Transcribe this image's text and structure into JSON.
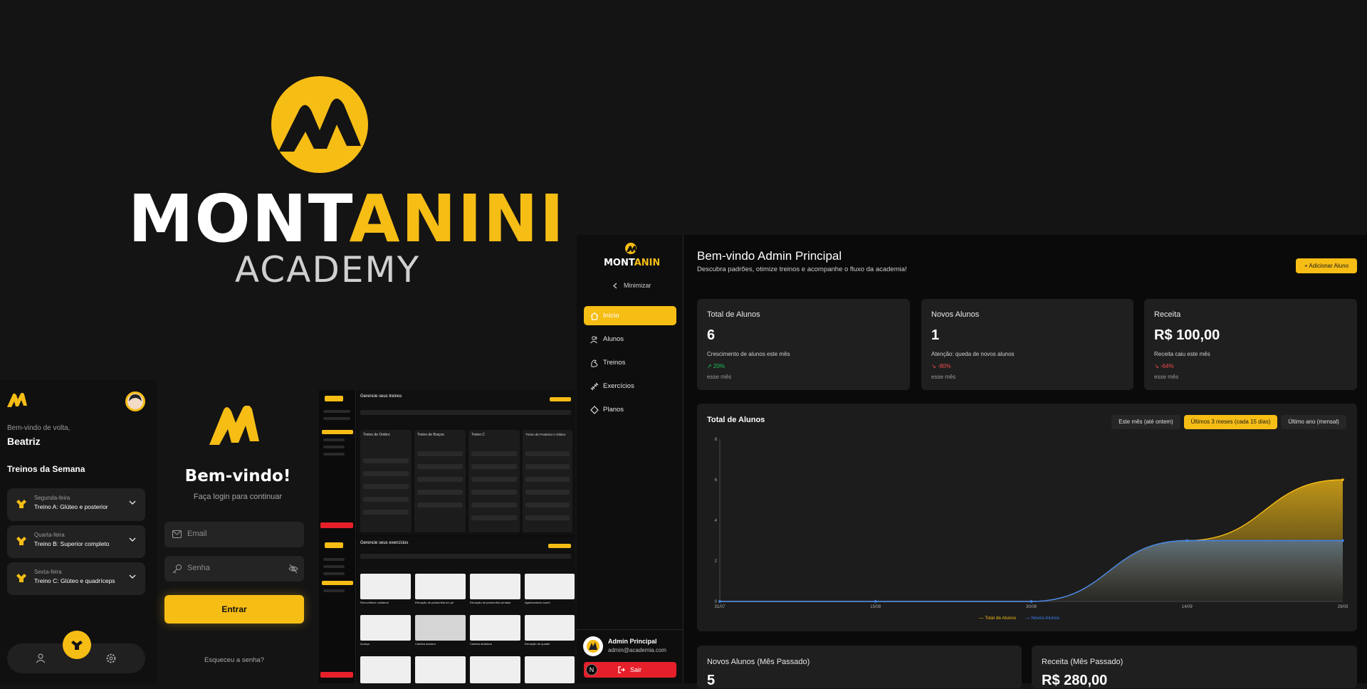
{
  "brand": {
    "word_white": "MONT",
    "word_yellow": "ANINI",
    "subtitle": "ACADEMY",
    "accent": "#f6bd15"
  },
  "mobile": {
    "greeting": "Bem-vindo de volta,",
    "user_name": "Beatriz",
    "section_title": "Treinos da Semana",
    "workouts": [
      {
        "day": "Segunda-feira",
        "title": "Treino A: Glúteo e posterior"
      },
      {
        "day": "Quarta-feira",
        "title": "Treino B: Superior completo"
      },
      {
        "day": "Sexta-feira",
        "title": "Treino C: Glúteo e quadríceps"
      }
    ],
    "nav_icons": [
      "user-icon",
      "dumbbell-icon",
      "gear-icon"
    ]
  },
  "login": {
    "title": "Bem-vindo!",
    "subtitle": "Faça login para continuar",
    "email_placeholder": "Email",
    "password_placeholder": "Senha",
    "submit_label": "Entrar",
    "forgot_label": "Esqueceu a senha?"
  },
  "mini": {
    "screen1_title": "Gerencie seus treinos",
    "screen1_columns": [
      "Treino de Ombro",
      "Treino de Braços",
      "Treino C",
      "Treino de Posterior e Glúteo"
    ],
    "screen2_title": "Gerencie seus exercícios",
    "screen2_captions": [
      "Remo/sflexe unilateral",
      "Elevação de panturrilha em pé",
      "Elevação de panturrilha sentado",
      "Agachamento sumô",
      "Avanço",
      "Cadeira adutora",
      "Cadeira abdutora",
      "Elevação de quadril"
    ]
  },
  "admin": {
    "sidebar": {
      "minimize_label": "Minimizar",
      "items": [
        {
          "label": "Início",
          "icon": "home-icon",
          "active": true
        },
        {
          "label": "Alunos",
          "icon": "users-icon",
          "active": false
        },
        {
          "label": "Treinos",
          "icon": "flex-icon",
          "active": false
        },
        {
          "label": "Exercícios",
          "icon": "dumbbell-icon",
          "active": false
        },
        {
          "label": "Planos",
          "icon": "diamond-icon",
          "active": false
        }
      ],
      "user_name": "Admin Principal",
      "user_email": "admin@academia.com",
      "logout_label": "Sair",
      "n_badge": "N"
    },
    "header": {
      "title": "Bem-vindo Admin Principal",
      "subtitle": "Descubra padrões, otimize treinos e acompanhe o fluxo da academia!",
      "add_button": "+ Adicionar Aluno"
    },
    "stats": [
      {
        "title": "Total de Alunos",
        "value": "6",
        "desc": "Crescimento de alunos este mês",
        "pct": "↗ 20%",
        "trend": "up",
        "period": "esse mês"
      },
      {
        "title": "Novos Alunos",
        "value": "1",
        "desc": "Atenção: queda de novos alunos",
        "pct": "↘ -80%",
        "trend": "down",
        "period": "esse mês"
      },
      {
        "title": "Receita",
        "value": "R$ 100,00",
        "desc": "Receita caiu este mês",
        "pct": "↘ -64%",
        "trend": "down",
        "period": "esse mês"
      }
    ],
    "chart_title": "Total de Alunos",
    "range_buttons": [
      {
        "label": "Este mês (até ontem)",
        "selected": false
      },
      {
        "label": "Últimos 3 meses (cada 15 dias)",
        "selected": true
      },
      {
        "label": "Último ano (mensal)",
        "selected": false
      }
    ],
    "bottom_cards": [
      {
        "title": "Novos Alunos (Mês Passado)",
        "value": "5"
      },
      {
        "title": "Receita (Mês Passado)",
        "value": "R$ 280,00"
      }
    ]
  },
  "chart_data": {
    "type": "area",
    "title": "Total de Alunos",
    "categories": [
      "31/07",
      "15/08",
      "30/08",
      "14/09",
      "29/09"
    ],
    "ylim": [
      0,
      8
    ],
    "yticks": [
      "0",
      "2",
      "4",
      "6",
      "8"
    ],
    "series": [
      {
        "name": "Total de Alunos",
        "values": [
          0,
          0,
          0,
          3,
          6
        ],
        "color": "#f6bd15"
      },
      {
        "name": "Novos Alunos",
        "values": [
          0,
          0,
          0,
          3,
          3
        ],
        "color": "#3b82f6"
      }
    ],
    "grid": false,
    "legend": "bottom-center"
  }
}
